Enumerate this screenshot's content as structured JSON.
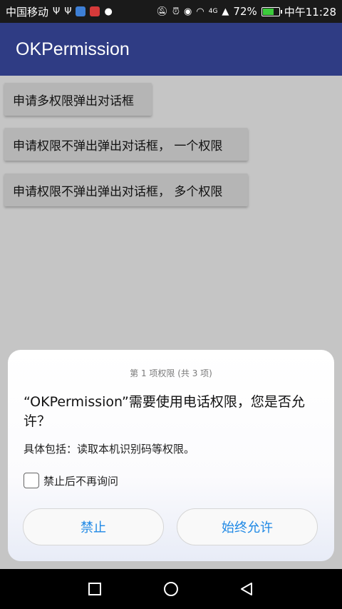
{
  "status_bar": {
    "carrier": "中国移动",
    "signal_label": "4G",
    "battery_percent": "72%",
    "battery_level": 0.72,
    "time": "中午11:28"
  },
  "app_bar": {
    "title": "OKPermission"
  },
  "buttons": [
    {
      "label": "申请多权限弹出对话框"
    },
    {
      "label": "申请权限不弹出弹出对话框，  一个权限"
    },
    {
      "label": "申请权限不弹出弹出对话框，  多个权限"
    }
  ],
  "dialog": {
    "step": "第 1 项权限 (共 3 项)",
    "title": "“OKPermission”需要使用电话权限，您是否允许？",
    "description": "具体包括：读取本机识别码等权限。",
    "checkbox_label": "禁止后不再询问",
    "deny_label": "禁止",
    "allow_label": "始终允许",
    "accent_color": "#1e88e5"
  },
  "colors": {
    "app_bar": "#2f3c84",
    "status_bar": "#1a1a1a",
    "scrim": "#c5c5c5"
  },
  "nav_bar": {
    "icons": [
      "recents-icon",
      "home-icon",
      "back-icon"
    ]
  }
}
